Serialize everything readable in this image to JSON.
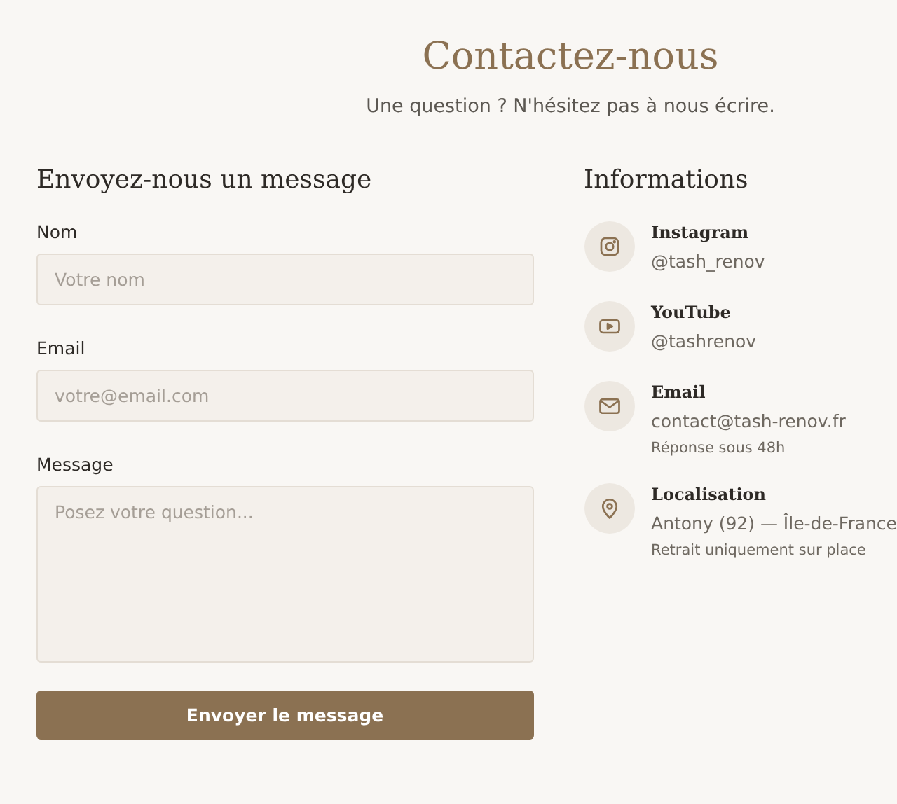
{
  "header": {
    "title": "Contactez-nous",
    "subtitle": "Une question ? N'hésitez pas à nous écrire."
  },
  "form": {
    "heading": "Envoyez-nous un message",
    "fields": [
      {
        "kind": "text",
        "label": "Nom",
        "placeholder": "Votre nom"
      },
      {
        "kind": "text",
        "label": "Email",
        "placeholder": "votre@email.com"
      },
      {
        "kind": "textarea",
        "label": "Message",
        "placeholder": "Posez votre question..."
      }
    ],
    "submit": "Envoyer le message"
  },
  "info": {
    "heading": "Informations",
    "items": [
      {
        "kind": "instagram",
        "title": "Instagram",
        "value": "@tash_renov"
      },
      {
        "kind": "youtube",
        "title": "YouTube",
        "value": "@tashrenov"
      },
      {
        "kind": "email",
        "title": "Email",
        "value": "contact@tash-renov.fr",
        "note": "Réponse sous 48h"
      },
      {
        "kind": "location",
        "title": "Localisation",
        "value": "Antony (92) — Île-de-France",
        "note": "Retrait uniquement sur place"
      }
    ]
  }
}
